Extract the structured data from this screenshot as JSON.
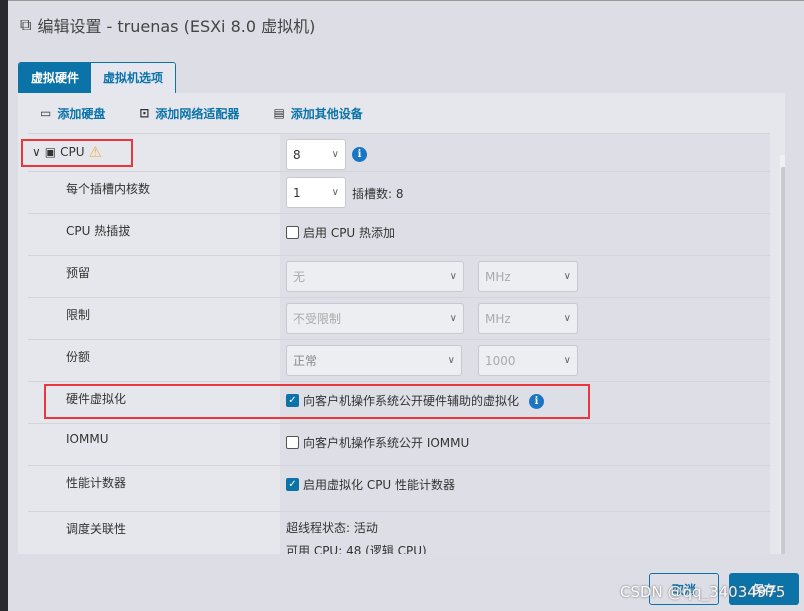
{
  "title": "编辑设置 - truenas (ESXi 8.0 虚拟机)",
  "tabs": [
    {
      "label": "虚拟硬件",
      "active": true
    },
    {
      "label": "虚拟机选项",
      "active": false
    }
  ],
  "toolbar": {
    "add_disk": "添加硬盘",
    "add_network": "添加网络适配器",
    "add_other": "添加其他设备"
  },
  "cpu": {
    "label": "CPU",
    "value": "8"
  },
  "cores": {
    "label": "每个插槽内核数",
    "value": "1",
    "sockets": "插槽数: 8"
  },
  "hotplug": {
    "label": "CPU 热插拔",
    "checkbox": "启用 CPU 热添加",
    "checked": false
  },
  "reservation": {
    "label": "预留",
    "value": "无",
    "unit": "MHz"
  },
  "limit": {
    "label": "限制",
    "value": "不受限制",
    "unit": "MHz"
  },
  "shares": {
    "label": "份额",
    "value": "正常",
    "amount": "1000"
  },
  "hwvirt": {
    "label": "硬件虚拟化",
    "checkbox": "向客户机操作系统公开硬件辅助的虚拟化",
    "checked": true
  },
  "iommu": {
    "label": "IOMMU",
    "checkbox": "向客户机操作系统公开 IOMMU",
    "checked": false
  },
  "perf": {
    "label": "性能计数器",
    "checkbox": "启用虚拟化 CPU 性能计数器",
    "checked": true
  },
  "affinity": {
    "label": "调度关联性",
    "ht": "超线程状态: 活动",
    "avail": "可用 CPU: 48 (逻辑 CPU)"
  },
  "buttons": {
    "cancel": "取消",
    "save": "保存"
  },
  "watermark": "CSDN @qq_34034975",
  "colors": {
    "accent": "#0c73a8",
    "highlight": "#e8383d",
    "warning": "#f0b04a"
  }
}
